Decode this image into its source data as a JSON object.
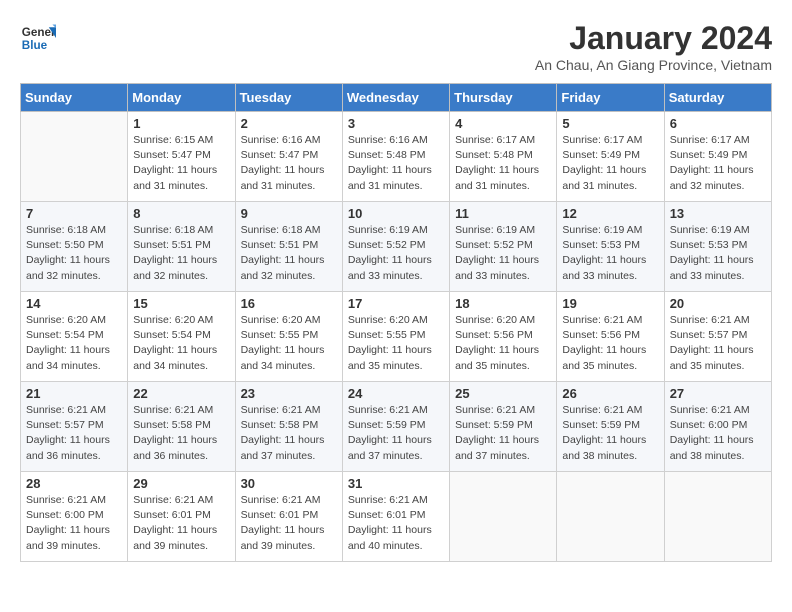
{
  "header": {
    "logo_line1": "General",
    "logo_line2": "Blue",
    "month": "January 2024",
    "location": "An Chau, An Giang Province, Vietnam"
  },
  "days_of_week": [
    "Sunday",
    "Monday",
    "Tuesday",
    "Wednesday",
    "Thursday",
    "Friday",
    "Saturday"
  ],
  "weeks": [
    [
      {
        "day": "",
        "info": ""
      },
      {
        "day": "1",
        "info": "Sunrise: 6:15 AM\nSunset: 5:47 PM\nDaylight: 11 hours\nand 31 minutes."
      },
      {
        "day": "2",
        "info": "Sunrise: 6:16 AM\nSunset: 5:47 PM\nDaylight: 11 hours\nand 31 minutes."
      },
      {
        "day": "3",
        "info": "Sunrise: 6:16 AM\nSunset: 5:48 PM\nDaylight: 11 hours\nand 31 minutes."
      },
      {
        "day": "4",
        "info": "Sunrise: 6:17 AM\nSunset: 5:48 PM\nDaylight: 11 hours\nand 31 minutes."
      },
      {
        "day": "5",
        "info": "Sunrise: 6:17 AM\nSunset: 5:49 PM\nDaylight: 11 hours\nand 31 minutes."
      },
      {
        "day": "6",
        "info": "Sunrise: 6:17 AM\nSunset: 5:49 PM\nDaylight: 11 hours\nand 32 minutes."
      }
    ],
    [
      {
        "day": "7",
        "info": "Sunrise: 6:18 AM\nSunset: 5:50 PM\nDaylight: 11 hours\nand 32 minutes."
      },
      {
        "day": "8",
        "info": "Sunrise: 6:18 AM\nSunset: 5:51 PM\nDaylight: 11 hours\nand 32 minutes."
      },
      {
        "day": "9",
        "info": "Sunrise: 6:18 AM\nSunset: 5:51 PM\nDaylight: 11 hours\nand 32 minutes."
      },
      {
        "day": "10",
        "info": "Sunrise: 6:19 AM\nSunset: 5:52 PM\nDaylight: 11 hours\nand 33 minutes."
      },
      {
        "day": "11",
        "info": "Sunrise: 6:19 AM\nSunset: 5:52 PM\nDaylight: 11 hours\nand 33 minutes."
      },
      {
        "day": "12",
        "info": "Sunrise: 6:19 AM\nSunset: 5:53 PM\nDaylight: 11 hours\nand 33 minutes."
      },
      {
        "day": "13",
        "info": "Sunrise: 6:19 AM\nSunset: 5:53 PM\nDaylight: 11 hours\nand 33 minutes."
      }
    ],
    [
      {
        "day": "14",
        "info": "Sunrise: 6:20 AM\nSunset: 5:54 PM\nDaylight: 11 hours\nand 34 minutes."
      },
      {
        "day": "15",
        "info": "Sunrise: 6:20 AM\nSunset: 5:54 PM\nDaylight: 11 hours\nand 34 minutes."
      },
      {
        "day": "16",
        "info": "Sunrise: 6:20 AM\nSunset: 5:55 PM\nDaylight: 11 hours\nand 34 minutes."
      },
      {
        "day": "17",
        "info": "Sunrise: 6:20 AM\nSunset: 5:55 PM\nDaylight: 11 hours\nand 35 minutes."
      },
      {
        "day": "18",
        "info": "Sunrise: 6:20 AM\nSunset: 5:56 PM\nDaylight: 11 hours\nand 35 minutes."
      },
      {
        "day": "19",
        "info": "Sunrise: 6:21 AM\nSunset: 5:56 PM\nDaylight: 11 hours\nand 35 minutes."
      },
      {
        "day": "20",
        "info": "Sunrise: 6:21 AM\nSunset: 5:57 PM\nDaylight: 11 hours\nand 35 minutes."
      }
    ],
    [
      {
        "day": "21",
        "info": "Sunrise: 6:21 AM\nSunset: 5:57 PM\nDaylight: 11 hours\nand 36 minutes."
      },
      {
        "day": "22",
        "info": "Sunrise: 6:21 AM\nSunset: 5:58 PM\nDaylight: 11 hours\nand 36 minutes."
      },
      {
        "day": "23",
        "info": "Sunrise: 6:21 AM\nSunset: 5:58 PM\nDaylight: 11 hours\nand 37 minutes."
      },
      {
        "day": "24",
        "info": "Sunrise: 6:21 AM\nSunset: 5:59 PM\nDaylight: 11 hours\nand 37 minutes."
      },
      {
        "day": "25",
        "info": "Sunrise: 6:21 AM\nSunset: 5:59 PM\nDaylight: 11 hours\nand 37 minutes."
      },
      {
        "day": "26",
        "info": "Sunrise: 6:21 AM\nSunset: 5:59 PM\nDaylight: 11 hours\nand 38 minutes."
      },
      {
        "day": "27",
        "info": "Sunrise: 6:21 AM\nSunset: 6:00 PM\nDaylight: 11 hours\nand 38 minutes."
      }
    ],
    [
      {
        "day": "28",
        "info": "Sunrise: 6:21 AM\nSunset: 6:00 PM\nDaylight: 11 hours\nand 39 minutes."
      },
      {
        "day": "29",
        "info": "Sunrise: 6:21 AM\nSunset: 6:01 PM\nDaylight: 11 hours\nand 39 minutes."
      },
      {
        "day": "30",
        "info": "Sunrise: 6:21 AM\nSunset: 6:01 PM\nDaylight: 11 hours\nand 39 minutes."
      },
      {
        "day": "31",
        "info": "Sunrise: 6:21 AM\nSunset: 6:01 PM\nDaylight: 11 hours\nand 40 minutes."
      },
      {
        "day": "",
        "info": ""
      },
      {
        "day": "",
        "info": ""
      },
      {
        "day": "",
        "info": ""
      }
    ]
  ]
}
